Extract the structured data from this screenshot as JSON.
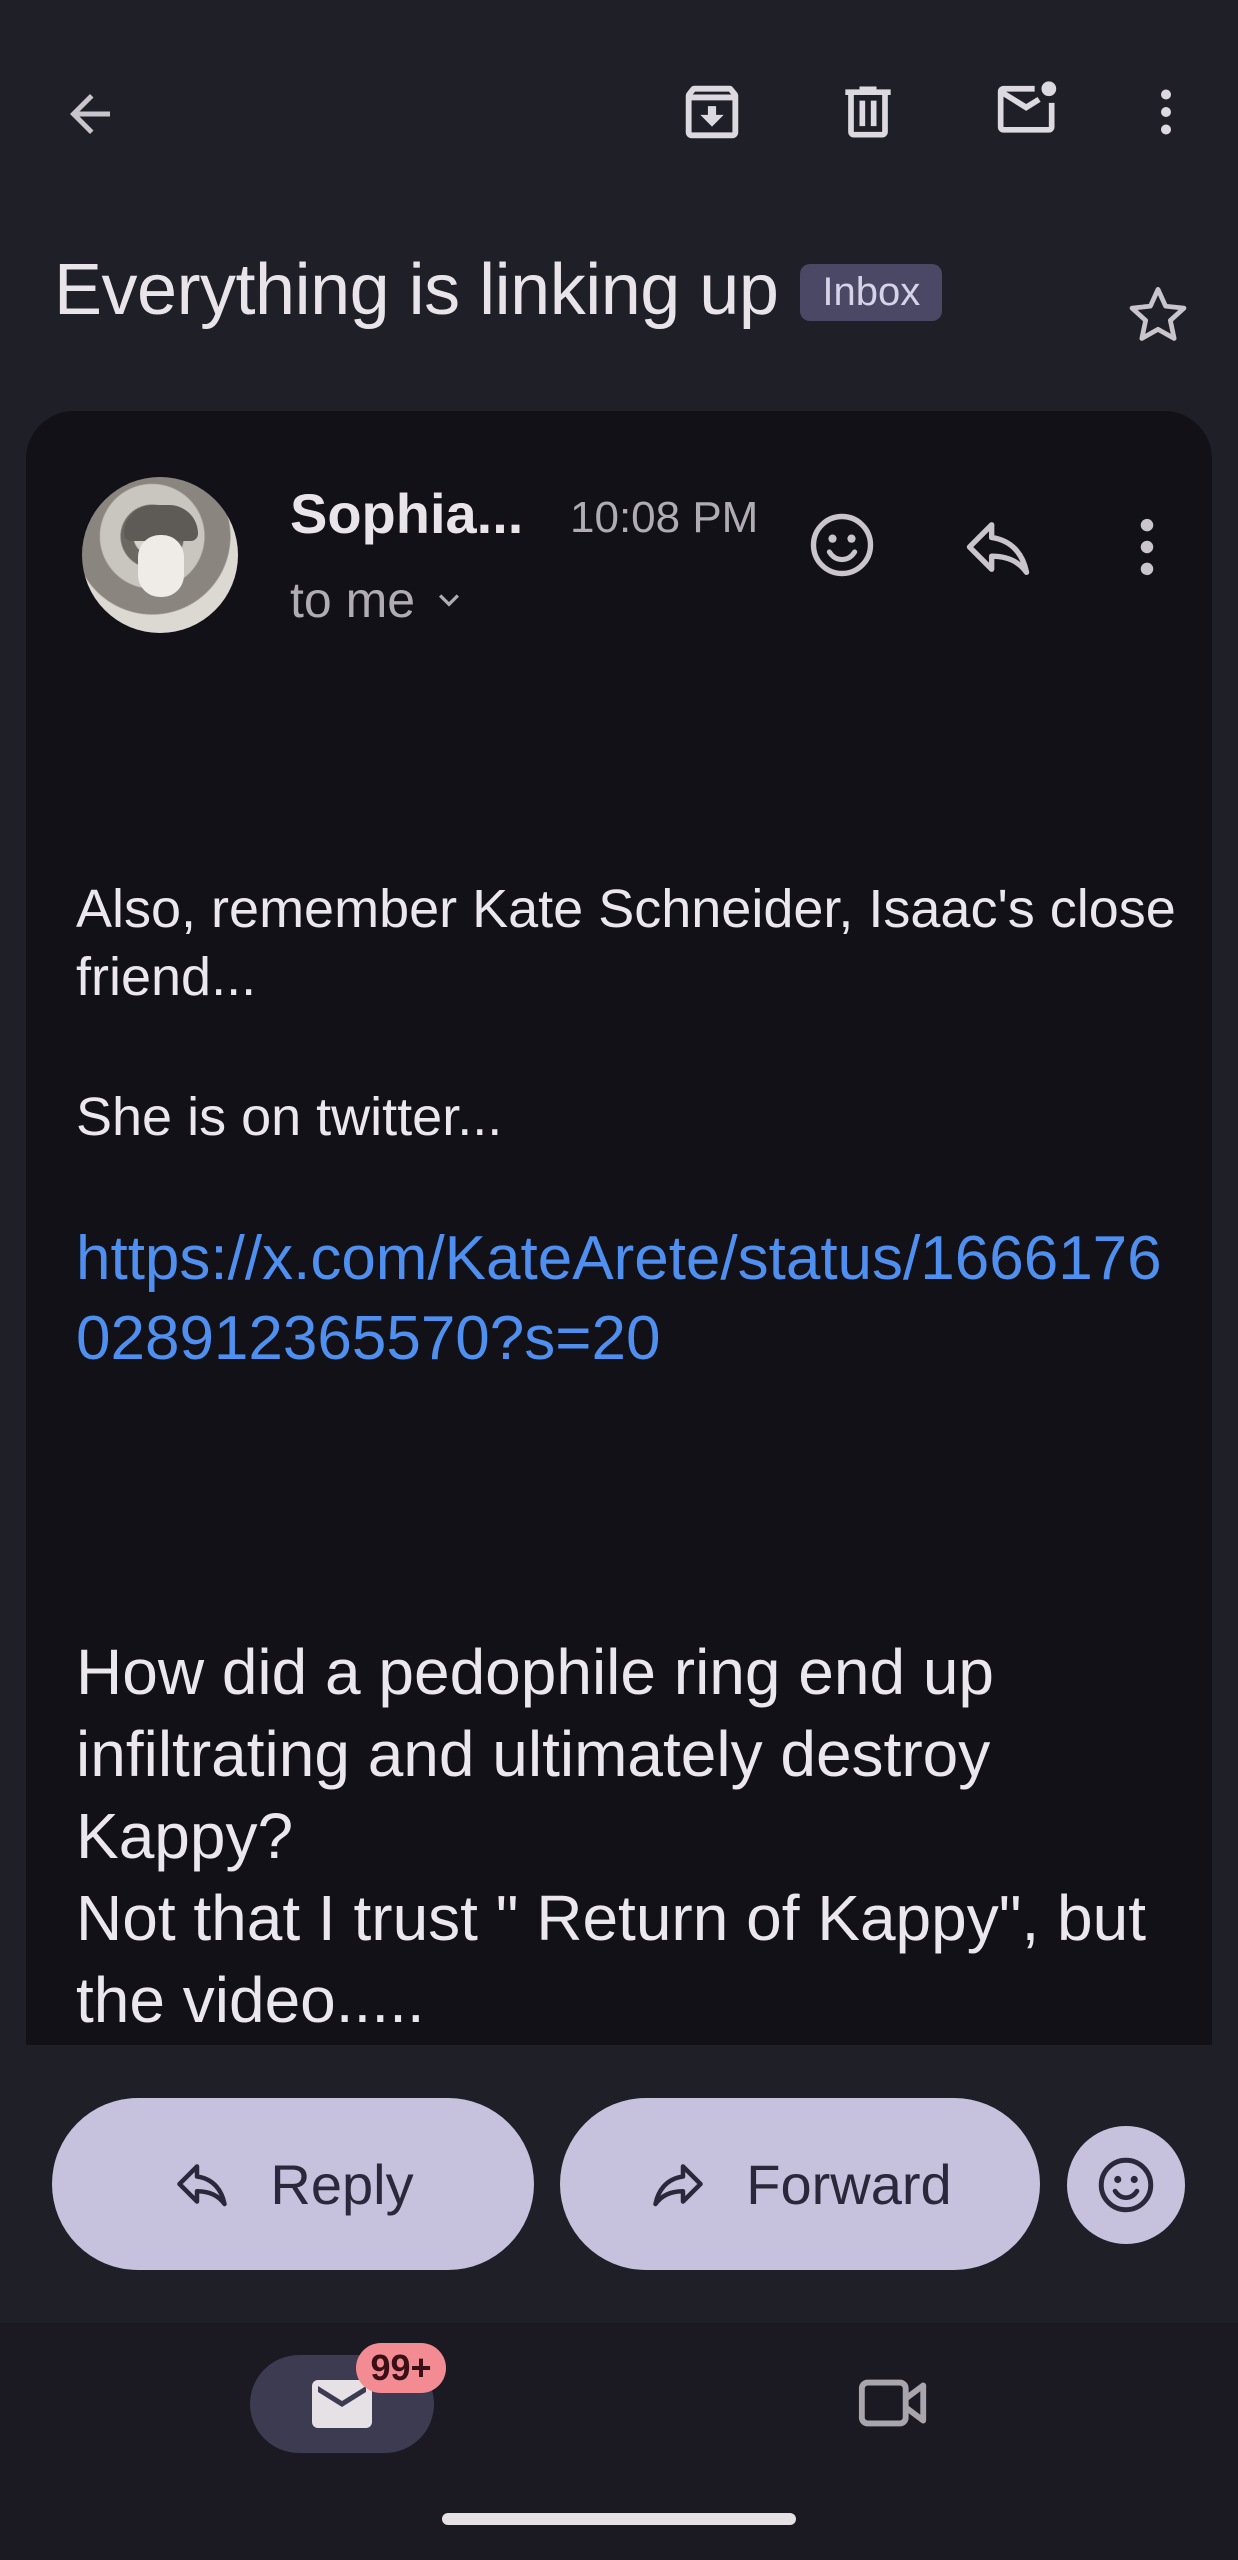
{
  "email": {
    "subject": "Everything is linking up",
    "label": "Inbox",
    "sender": "Sophia...",
    "time": "10:08 PM",
    "recipient": "to me",
    "body": {
      "p1": "Also, remember Kate Schneider, Isaac's close friend...",
      "p2": "She is on twitter...",
      "link": "https://x.com/KateArete/status/1666176028912365570?s=20",
      "p3_line1": "How did a pedophile ring end up infiltrating and ultimately destroy Kappy?",
      "p3_line2": "Not that I trust \" Return of Kappy\", but the video....."
    }
  },
  "actions": {
    "reply_label": "Reply",
    "forward_label": "Forward"
  },
  "nav": {
    "mail_badge": "99+"
  },
  "colors": {
    "background": "#1f1f27",
    "card": "#121117",
    "link": "#4f8ff0",
    "pill": "#c6c2de",
    "badge": "#f28b92",
    "inbox_badge": "#4a4864"
  },
  "icons": [
    "back-arrow-icon",
    "archive-icon",
    "delete-icon",
    "mark-unread-icon",
    "more-vert-icon",
    "star-icon",
    "emoji-icon",
    "reply-icon",
    "forward-icon",
    "mail-icon",
    "video-icon"
  ]
}
